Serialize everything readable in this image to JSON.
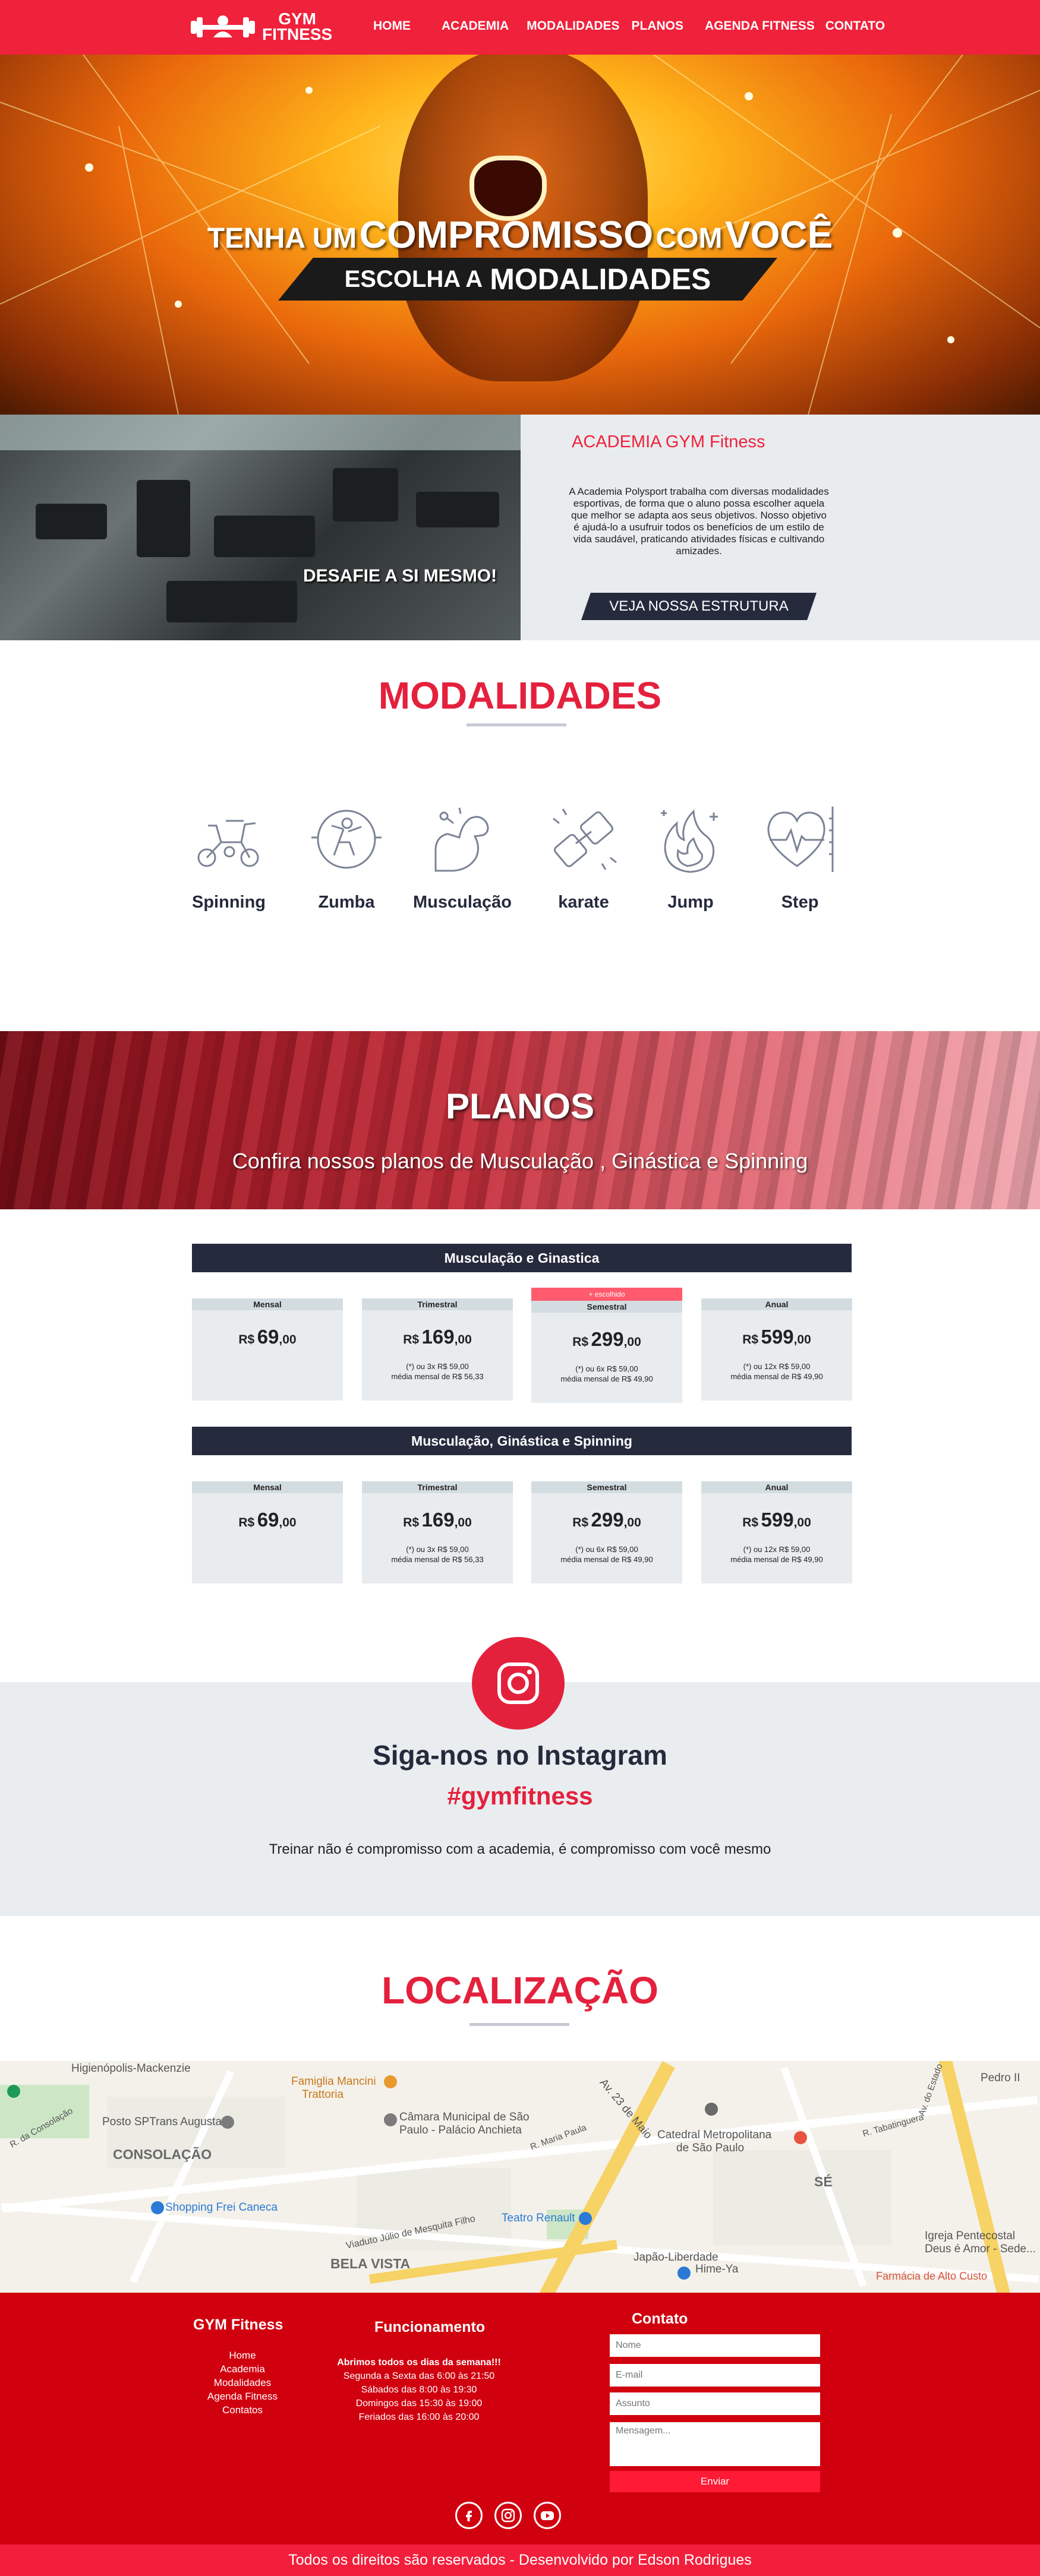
{
  "header": {
    "logo_line1": "GYM",
    "logo_line2": "FITNESS",
    "nav": [
      "HOME",
      "ACADEMIA",
      "MODALIDADES",
      "PLANOS",
      "AGENDA FITNESS",
      "CONTATO"
    ]
  },
  "hero": {
    "title_a": "TENHA UM",
    "title_b": "COMPROMISSO",
    "title_c": "COM",
    "title_d": "VOCÊ",
    "band_a": "ESCOLHA A",
    "band_b": "MODALIDADES"
  },
  "academia": {
    "photo_caption": "DESAFIE A SI MESMO!",
    "title": "ACADEMIA GYM Fitness",
    "text": "A Academia Polysport trabalha com diversas modalidades esportivas, de forma que o aluno possa escolher aquela que melhor se adapta aos seus objetivos. Nosso objetivo é ajudá-lo a usufruir todos os benefícios de um estilo de vida saudável, praticando atividades físicas e cultivando amizades.",
    "button": "VEJA NOSSA ESTRUTURA"
  },
  "modalidades": {
    "title": "MODALIDADES",
    "items": [
      {
        "label": "Spinning",
        "icon": "bike-icon"
      },
      {
        "label": "Zumba",
        "icon": "dance-icon"
      },
      {
        "label": "Musculação",
        "icon": "muscle-icon"
      },
      {
        "label": "karate",
        "icon": "fist-icon"
      },
      {
        "label": "Jump",
        "icon": "fire-icon"
      },
      {
        "label": "Step",
        "icon": "heart-pulse-icon"
      }
    ]
  },
  "planos": {
    "title": "PLANOS",
    "subtitle": "Confira nossos planos de Musculação , Ginástica e Spinning",
    "groups": [
      {
        "title": "Musculação e Ginastica",
        "plans": [
          {
            "period": "Mensal",
            "currency": "R$",
            "price": "69",
            "cents": ",00",
            "note1": "",
            "note2": ""
          },
          {
            "period": "Trimestral",
            "currency": "R$",
            "price": "169",
            "cents": ",00",
            "note1": "(*) ou 3x R$ 59,00",
            "note2": "média mensal de R$ 56,33"
          },
          {
            "period": "Semestral",
            "currency": "R$",
            "price": "299",
            "cents": ",00",
            "note1": "(*) ou 6x R$ 59,00",
            "note2": "média mensal de R$ 49,90"
          },
          {
            "period": "Anual",
            "currency": "R$",
            "price": "599",
            "cents": ",00",
            "note1": "(*) ou 12x R$ 59,00",
            "note2": "média mensal de R$ 49,90"
          }
        ]
      },
      {
        "title": "Musculação, Ginástica e Spinning",
        "plans": [
          {
            "period": "Mensal",
            "currency": "R$",
            "price": "69",
            "cents": ",00",
            "note1": "",
            "note2": ""
          },
          {
            "period": "Trimestral",
            "currency": "R$",
            "price": "169",
            "cents": ",00",
            "note1": "(*) ou 3x R$ 59,00",
            "note2": "média mensal de R$ 56,33"
          },
          {
            "period": "Semestral",
            "currency": "R$",
            "price": "299",
            "cents": ",00",
            "note1": "(*) ou 6x R$ 59,00",
            "note2": "média mensal de R$ 49,90"
          },
          {
            "period": "Anual",
            "currency": "R$",
            "price": "599",
            "cents": ",00",
            "note1": "(*) ou 12x R$ 59,00",
            "note2": "média mensal de R$ 49,90"
          }
        ]
      }
    ],
    "badge": "+ escolhido"
  },
  "instagram": {
    "title": "Siga-nos no Instagram",
    "hashtag": "#gymfitness",
    "text": "Treinar não é compromisso com a academia, é compromisso com você mesmo"
  },
  "localizacao": {
    "title": "LOCALIZAÇÃO",
    "map_labels": {
      "l1": "Higienópolis-Mackenzie",
      "l2": "Famiglia Mancini",
      "l3": "Trattoria",
      "l4": "Posto SPTrans Augusta",
      "l5": "Câmara Municipal de São",
      "l6": "Paulo - Palácio Anchieta",
      "l7": "CONSOLAÇÃO",
      "l8": "Catedral Metropolitana",
      "l9": "de São Paulo",
      "l10": "SÉ",
      "l11": "Shopping Frei Caneca",
      "l12": "Teatro Renault",
      "l13": "BELA VISTA",
      "l14": "Japão-Liberdade",
      "l15": "Hime-Ya",
      "l16": "Igreja Pentecostal",
      "l17": "Deus é Amor - Sede...",
      "l18": "Farmácia de Alto Custo",
      "l19": "Pedro II",
      "l20": "Av. 23 de Maio",
      "l21": "R. da Consolação",
      "l22": "Viaduto Júlio de Mesquita Filho",
      "l23": "R. Maria Paula",
      "l24": "R. Tabatinguera",
      "l25": "Av. do Estado"
    }
  },
  "footer": {
    "col1_title": "GYM Fitness",
    "links": [
      "Home",
      "Academia",
      "Modalidades",
      "Agenda Fitness",
      "Contatos"
    ],
    "col2_title": "Funcionamento",
    "hours_bold": "Abrimos todos os dias da semana!!!",
    "hours": [
      "Segunda a Sexta das 6:00 às 21:50",
      "Sábados das 8:00 às 19:30",
      "Domingos das 15:30 às 19:00",
      "Feriados das 16:00 às 20:00"
    ],
    "col3_title": "Contato",
    "form": {
      "name_placeholder": "Nome",
      "email_placeholder": "E-mail",
      "subject_placeholder": "Assunto",
      "message_placeholder": "Mensagem...",
      "send": "Enviar"
    },
    "copyright": "Todos os direitos são reservados - Desenvolvido por Edson Rodrigues"
  }
}
